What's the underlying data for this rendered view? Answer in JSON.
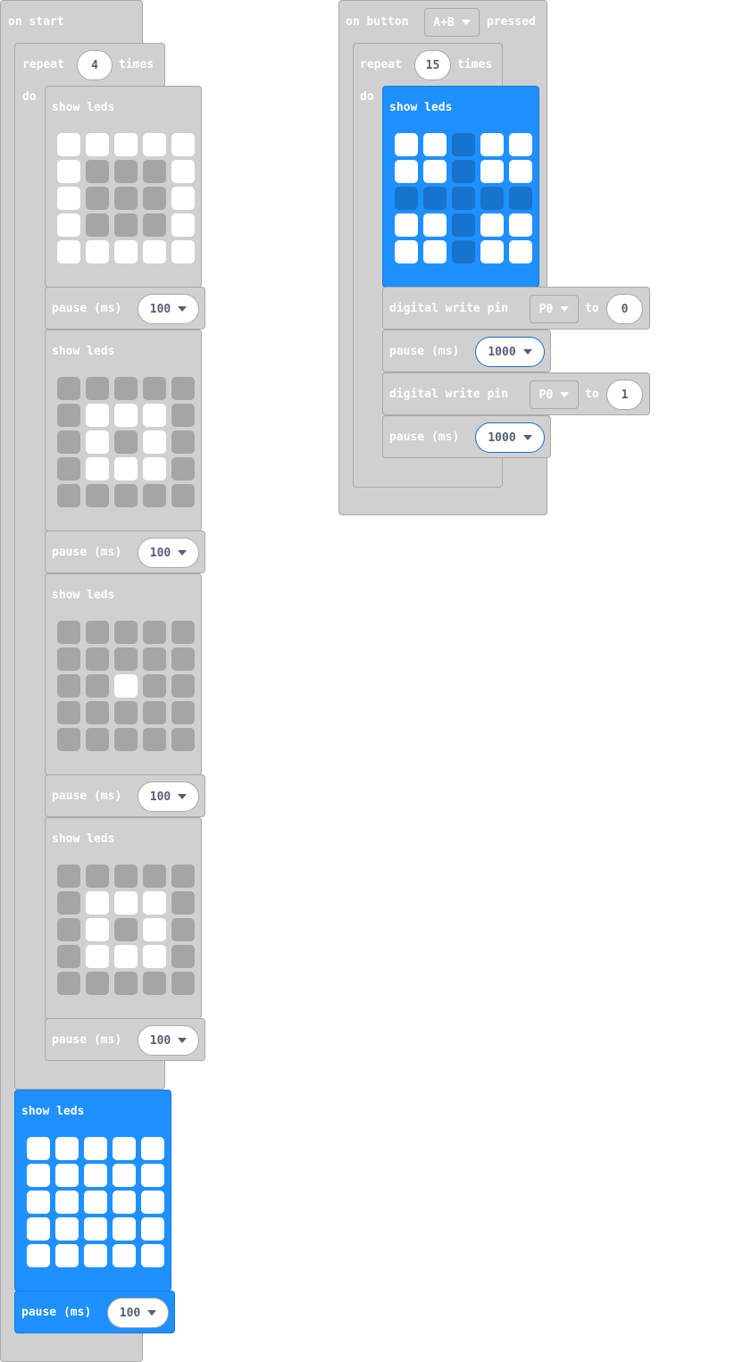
{
  "on_start": {
    "label": "on start",
    "repeat": {
      "label": "repeat",
      "count": "4",
      "times": "times",
      "do": "do"
    },
    "show_leds": [
      {
        "label": "show leds",
        "pattern": [
          "11111",
          "10001",
          "10001",
          "10001",
          "11111"
        ]
      },
      {
        "label": "show leds",
        "pattern": [
          "00000",
          "01110",
          "01010",
          "01110",
          "00000"
        ]
      },
      {
        "label": "show leds",
        "pattern": [
          "00000",
          "00000",
          "00100",
          "00000",
          "00000"
        ]
      },
      {
        "label": "show leds",
        "pattern": [
          "00000",
          "01110",
          "01010",
          "01110",
          "00000"
        ]
      }
    ],
    "pauses": [
      {
        "label": "pause (ms)",
        "value": "100"
      },
      {
        "label": "pause (ms)",
        "value": "100"
      },
      {
        "label": "pause (ms)",
        "value": "100"
      },
      {
        "label": "pause (ms)",
        "value": "100"
      }
    ],
    "final_show_leds": {
      "label": "show leds",
      "pattern": [
        "11111",
        "11111",
        "11111",
        "11111",
        "11111"
      ]
    },
    "final_pause": {
      "label": "pause (ms)",
      "value": "100"
    }
  },
  "on_button": {
    "label_on": "on button",
    "button": "A+B",
    "label_pressed": "pressed",
    "repeat": {
      "label": "repeat",
      "count": "15",
      "times": "times",
      "do": "do"
    },
    "show_leds": {
      "label": "show leds",
      "pattern": [
        "11011",
        "11011",
        "00000",
        "11011",
        "11011"
      ]
    },
    "write1": {
      "label": "digital write pin",
      "pin": "P0",
      "to": "to",
      "value": "0"
    },
    "pause1": {
      "label": "pause (ms)",
      "value": "1000"
    },
    "write2": {
      "label": "digital write pin",
      "pin": "P0",
      "to": "to",
      "value": "1"
    },
    "pause2": {
      "label": "pause (ms)",
      "value": "1000"
    }
  },
  "colors": {
    "block_gray": "#d0d0d0",
    "block_blue": "#1e90ff",
    "led_off_gray": "#a5a5a5",
    "led_off_blue": "#1873cc"
  }
}
